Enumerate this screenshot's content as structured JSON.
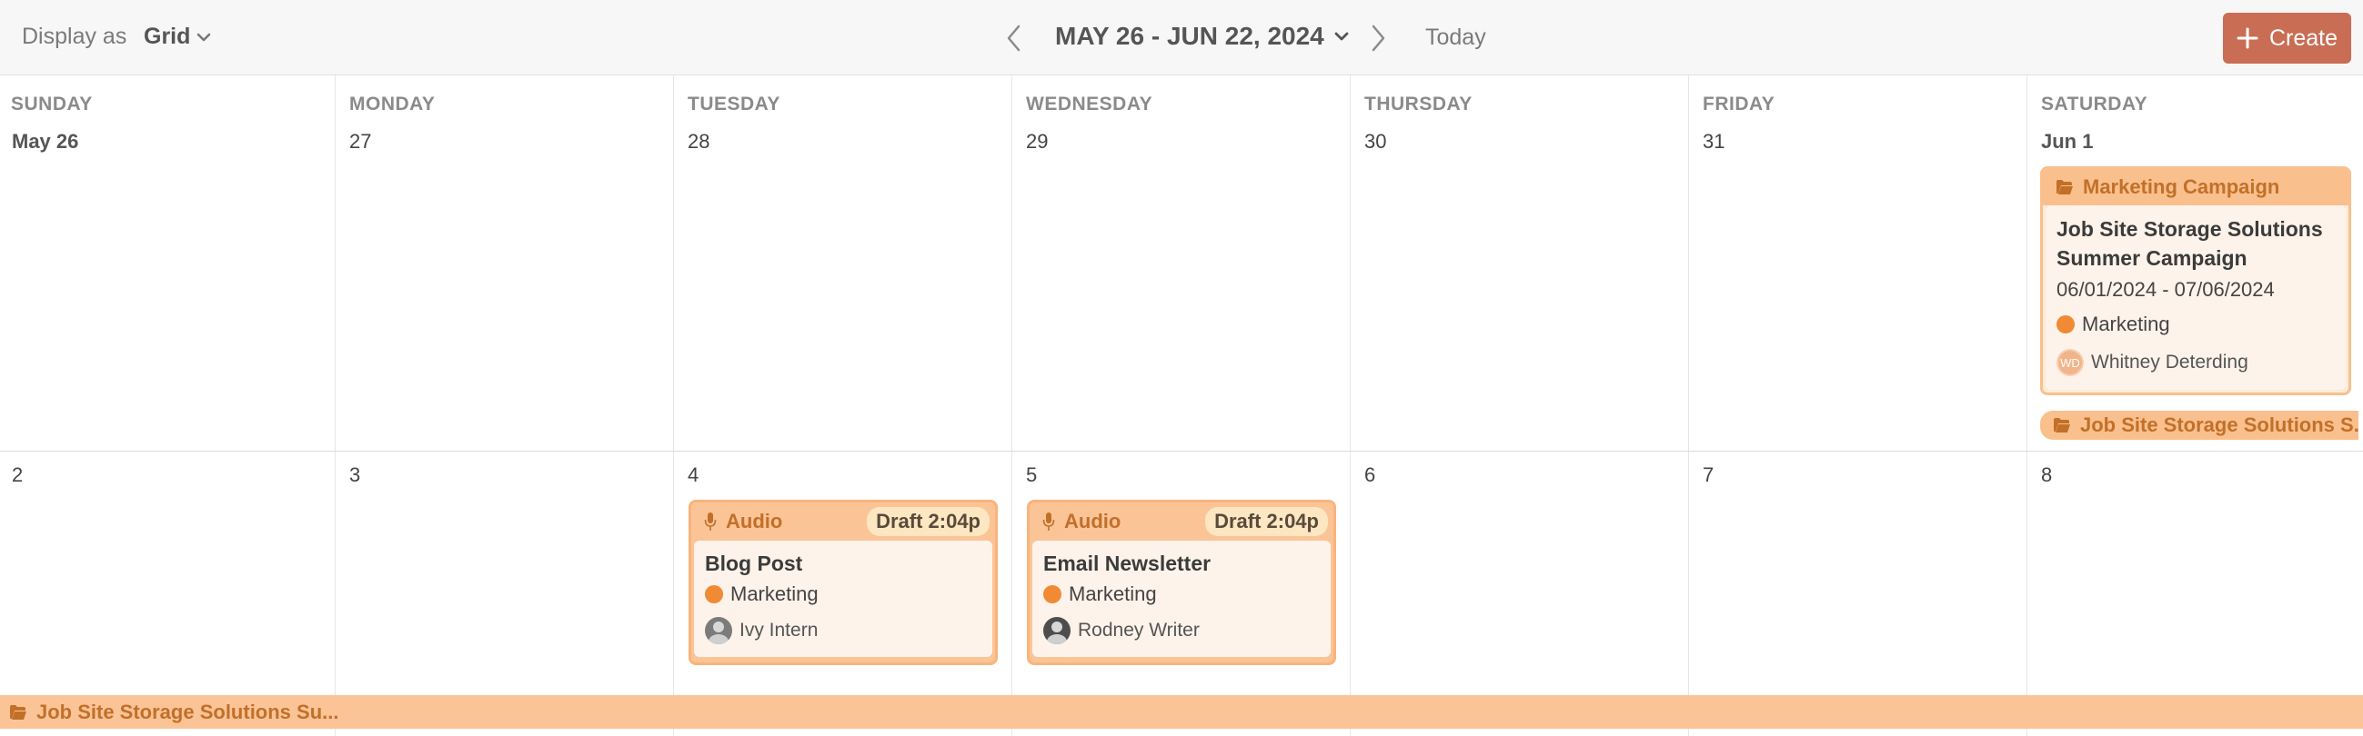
{
  "toolbar": {
    "display_as_label": "Display as",
    "view_mode": "Grid",
    "date_range": "MAY 26 - JUN 22, 2024",
    "today_label": "Today",
    "create_label": "Create"
  },
  "weekdays": [
    "SUNDAY",
    "MONDAY",
    "TUESDAY",
    "WEDNESDAY",
    "THURSDAY",
    "FRIDAY",
    "SATURDAY"
  ],
  "week1_dates": [
    "May 26",
    "27",
    "28",
    "29",
    "30",
    "31",
    "Jun 1"
  ],
  "week2_dates": [
    "2",
    "3",
    "4",
    "5",
    "6",
    "7",
    "8"
  ],
  "campaign": {
    "category": "Marketing Campaign",
    "title": "Job Site Storage Solutions Summer Campaign",
    "dates": "06/01/2024 - 07/06/2024",
    "tag": "Marketing",
    "owner_initials": "WD",
    "owner": "Whitney Deterding"
  },
  "span_bars": {
    "saturday_label": "Job Site Storage Solutions S...",
    "week2_label": "Job Site Storage Solutions Su..."
  },
  "content_items": [
    {
      "type": "Audio",
      "status": "Draft 2:04p",
      "title": "Blog Post",
      "tag": "Marketing",
      "owner": "Ivy Intern"
    },
    {
      "type": "Audio",
      "status": "Draft 2:04p",
      "title": "Email Newsletter",
      "tag": "Marketing",
      "owner": "Rodney Writer"
    }
  ],
  "colors": {
    "accent": "#c96d55",
    "campaign_header": "#f9c08e",
    "campaign_text": "#c27029",
    "tag_dot": "#f08a35"
  },
  "icons": {
    "grid_dropdown": "chevron-down-icon",
    "prev": "chevron-left-icon",
    "next": "chevron-right-icon",
    "create": "plus-icon",
    "campaign": "folder-open-icon",
    "audio": "microphone-icon"
  }
}
